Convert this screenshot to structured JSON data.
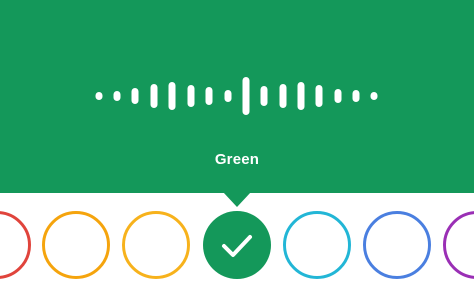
{
  "selected_color": {
    "label": "Green",
    "hex": "#14985a"
  },
  "swatches": [
    {
      "name": "red",
      "hex": "#e0443c",
      "selected": false
    },
    {
      "name": "orange",
      "hex": "#f5a40d",
      "selected": false
    },
    {
      "name": "yellow",
      "hex": "#f7b21c",
      "selected": false
    },
    {
      "name": "green",
      "hex": "#14985a",
      "selected": true
    },
    {
      "name": "cyan",
      "hex": "#22b6d6",
      "selected": false
    },
    {
      "name": "blue",
      "hex": "#4a7fe0",
      "selected": false
    },
    {
      "name": "purple",
      "hex": "#9a2fb5",
      "selected": false
    }
  ],
  "icons": {
    "waveform": "audio-waveform-icon",
    "selected": "checkmark-icon"
  }
}
